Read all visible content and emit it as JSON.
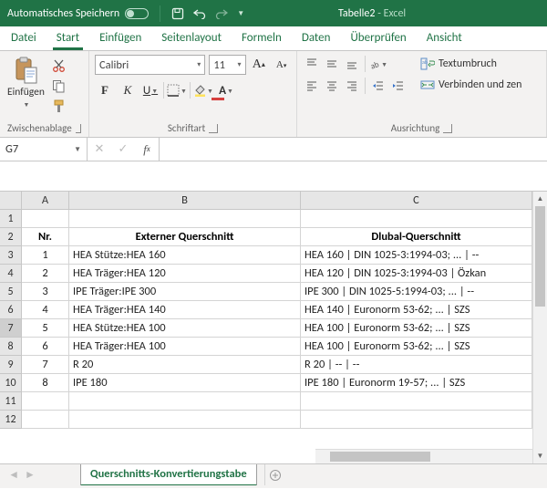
{
  "title": {
    "autosave": "Automatisches Speichern",
    "doc": "Tabelle2",
    "app": "Excel"
  },
  "tabs": {
    "file": "Datei",
    "home": "Start",
    "insert": "Einfügen",
    "pageLayout": "Seitenlayout",
    "formulas": "Formeln",
    "data": "Daten",
    "review": "Überprüfen",
    "view": "Ansicht"
  },
  "ribbon": {
    "clipboard": {
      "paste": "Einfügen",
      "label": "Zwischenablage"
    },
    "font": {
      "name": "Calibri",
      "size": "11",
      "bold": "F",
      "italic": "K",
      "underline": "U",
      "label": "Schriftart"
    },
    "align": {
      "wrap": "Textumbruch",
      "merge": "Verbinden und zen",
      "label": "Ausrichtung"
    }
  },
  "namebox": "G7",
  "columns": [
    "A",
    "B",
    "C"
  ],
  "rows": [
    "1",
    "2",
    "3",
    "4",
    "5",
    "6",
    "7",
    "8",
    "9",
    "10",
    "11",
    "12"
  ],
  "headers": {
    "nr": "Nr.",
    "ext": "Externer Querschnitt",
    "dlubal": "Dlubal-Querschnitt"
  },
  "data": [
    {
      "nr": "1",
      "ext": "HEA Stütze:HEA 160",
      "dlubal": "HEA 160 | DIN 1025-3:1994-03; ... | --"
    },
    {
      "nr": "2",
      "ext": "HEA Träger:HEA 120",
      "dlubal": "HEA 120 | DIN 1025-3:1994-03 | Özkan"
    },
    {
      "nr": "3",
      "ext": "IPE Träger:IPE 300",
      "dlubal": "IPE 300 | DIN 1025-5:1994-03; ... | --"
    },
    {
      "nr": "4",
      "ext": "HEA Träger:HEA 140",
      "dlubal": "HEA 140 | Euronorm 53-62; ... | SZS"
    },
    {
      "nr": "5",
      "ext": "HEA Stütze:HEA 100",
      "dlubal": "HEA 100 | Euronorm 53-62; ... | SZS"
    },
    {
      "nr": "6",
      "ext": "HEA Träger:HEA 100",
      "dlubal": "HEA 100 | Euronorm 53-62; ... | SZS"
    },
    {
      "nr": "7",
      "ext": "R 20",
      "dlubal": "R 20 | -- | --"
    },
    {
      "nr": "8",
      "ext": "IPE 180",
      "dlubal": "IPE 180 | Euronorm 19-57; ... | SZS"
    }
  ],
  "sheet": {
    "name": "Querschnitts-Konvertierungstabe"
  }
}
